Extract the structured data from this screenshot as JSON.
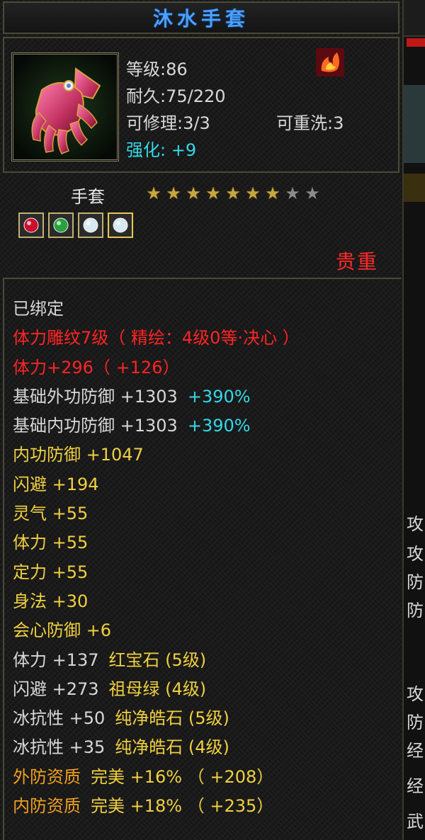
{
  "item": {
    "name": "沐水手套",
    "level_text": "等级:86",
    "durability_text": "耐久:75/220",
    "repair_text": "可修理:3/3",
    "rewash_text": "可重洗:3",
    "enhance_label": "强化:",
    "enhance_value": "+9",
    "type": "手套",
    "stars_total": 9,
    "stars_filled": 7,
    "quality": "贵重"
  },
  "gem_sockets": [
    {
      "icon": "ruby-gem-icon",
      "color": "#c8102e"
    },
    {
      "icon": "emerald-gem-icon",
      "color": "#2aa040"
    },
    {
      "icon": "diamond-gem-icon",
      "color": "#d8e8f0"
    },
    {
      "icon": "diamond-gem-icon",
      "color": "#d8e8f0"
    }
  ],
  "attributes": [
    {
      "parts": [
        {
          "text": "已绑定",
          "color": "white"
        }
      ]
    },
    {
      "parts": [
        {
          "text": "体力雕纹7级（ 精绘：4级0等·决心 ）",
          "color": "red"
        }
      ]
    },
    {
      "parts": [
        {
          "text": "体力+296（ +126）",
          "color": "red"
        }
      ]
    },
    {
      "parts": [
        {
          "text": "基础外功防御 +1303",
          "color": "white"
        },
        {
          "text": "+390%",
          "color": "lightcyan"
        }
      ]
    },
    {
      "parts": [
        {
          "text": "基础内功防御 +1303",
          "color": "white"
        },
        {
          "text": "+390%",
          "color": "lightcyan"
        }
      ]
    },
    {
      "parts": [
        {
          "text": "内功防御 +1047",
          "color": "yellow"
        }
      ]
    },
    {
      "parts": [
        {
          "text": "闪避 +194",
          "color": "yellow"
        }
      ]
    },
    {
      "parts": [
        {
          "text": "灵气 +55",
          "color": "yellow"
        }
      ]
    },
    {
      "parts": [
        {
          "text": "体力 +55",
          "color": "yellow"
        }
      ]
    },
    {
      "parts": [
        {
          "text": "定力 +55",
          "color": "yellow"
        }
      ]
    },
    {
      "parts": [
        {
          "text": "身法 +30",
          "color": "yellow"
        }
      ]
    },
    {
      "parts": [
        {
          "text": "会心防御 +6",
          "color": "yellow"
        }
      ]
    },
    {
      "parts": [
        {
          "text": "体力 +137",
          "color": "white"
        },
        {
          "text": "红宝石 (5级)",
          "color": "yellow"
        }
      ]
    },
    {
      "parts": [
        {
          "text": "闪避 +273",
          "color": "white"
        },
        {
          "text": "祖母绿 (4级)",
          "color": "yellow"
        }
      ]
    },
    {
      "parts": [
        {
          "text": "冰抗性 +50",
          "color": "white"
        },
        {
          "text": "纯净皓石 (5级)",
          "color": "yellow"
        }
      ]
    },
    {
      "parts": [
        {
          "text": "冰抗性 +35",
          "color": "white"
        },
        {
          "text": "纯净皓石 (4级)",
          "color": "yellow"
        }
      ]
    },
    {
      "parts": [
        {
          "text": "外防资质",
          "color": "orange"
        },
        {
          "text": "完美 +16% （ +208）",
          "color": "yellow"
        }
      ]
    },
    {
      "parts": [
        {
          "text": "内防资质",
          "color": "orange"
        },
        {
          "text": "完美 +18% （ +235）",
          "color": "yellow"
        }
      ]
    }
  ],
  "side_panel": {
    "chars": [
      "攻",
      "攻",
      "防",
      "防",
      "攻",
      "防",
      "经",
      "经",
      "武"
    ]
  },
  "colors": {
    "title": "#4aa0ff",
    "bound_text": "#d8d8d8",
    "engrave_red": "#ff2424",
    "bonus_yellow": "#f0d040",
    "aptitude_orange": "#f0a020",
    "cyan": "#34d8e8",
    "quality_red": "#ff2a2a",
    "star_on": "#c8a640",
    "star_off": "#8a8a8a"
  }
}
